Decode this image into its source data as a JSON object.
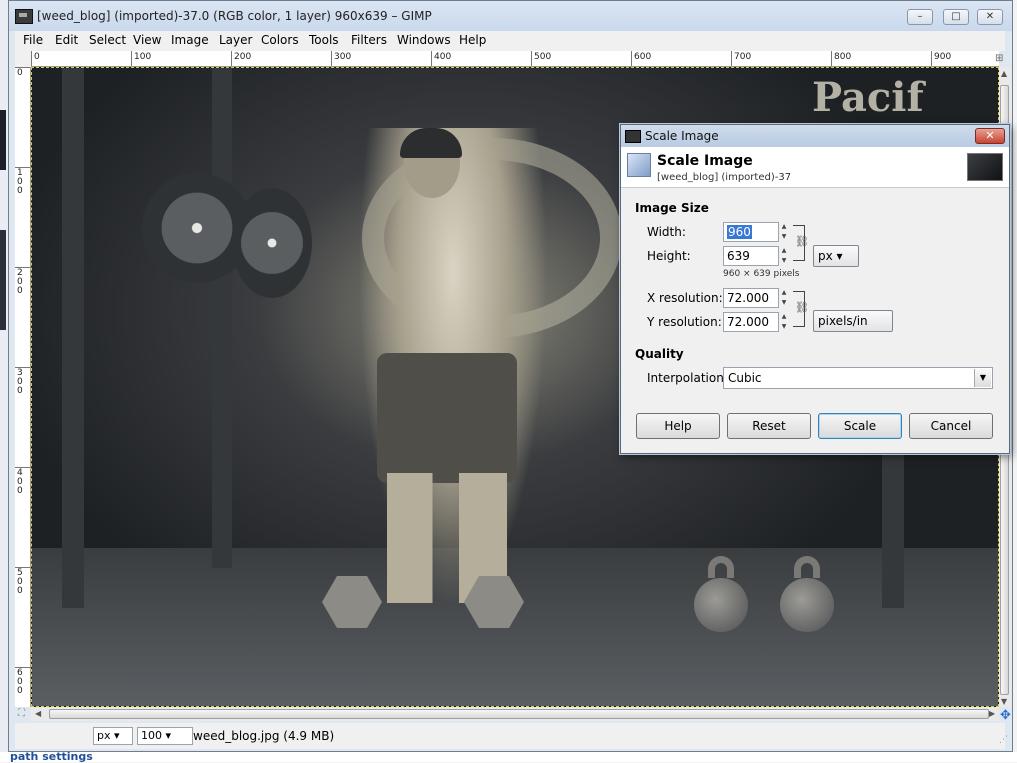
{
  "window": {
    "title": "[weed_blog] (imported)-37.0 (RGB color, 1 layer) 960x639 – GIMP",
    "controls": {
      "minimize": "–",
      "maximize": "□",
      "close": "✕"
    }
  },
  "menubar": [
    "File",
    "Edit",
    "Select",
    "View",
    "Image",
    "Layer",
    "Colors",
    "Tools",
    "Filters",
    "Windows",
    "Help"
  ],
  "ruler_top_labels": [
    "0",
    "100",
    "200",
    "300",
    "400",
    "500",
    "600",
    "700",
    "800",
    "900"
  ],
  "ruler_left_labels": [
    "0",
    "100",
    "200",
    "300",
    "400",
    "500",
    "600"
  ],
  "canvas": {
    "wall_text": "Pacif"
  },
  "statusbar": {
    "unit": "px",
    "zoom": "100",
    "file_info": "weed_blog.jpg (4.9 MB)"
  },
  "desktop_bottom_text": "path settings",
  "dialog": {
    "title": "Scale Image",
    "header_title": "Scale Image",
    "header_subtitle": "[weed_blog] (imported)-37",
    "image_size_title": "Image Size",
    "width_label": "Width:",
    "width_value": "960",
    "height_label": "Height:",
    "height_value": "639",
    "size_unit": "px",
    "pixel_note": "960 × 639 pixels",
    "xres_label": "X resolution:",
    "xres_value": "72.000",
    "yres_label": "Y resolution:",
    "yres_value": "72.000",
    "res_unit": "pixels/in",
    "quality_title": "Quality",
    "interp_label": "Interpolation:",
    "interp_value": "Cubic",
    "buttons": {
      "help": "Help",
      "reset": "Reset",
      "scale": "Scale",
      "cancel": "Cancel"
    },
    "close": "✕"
  }
}
